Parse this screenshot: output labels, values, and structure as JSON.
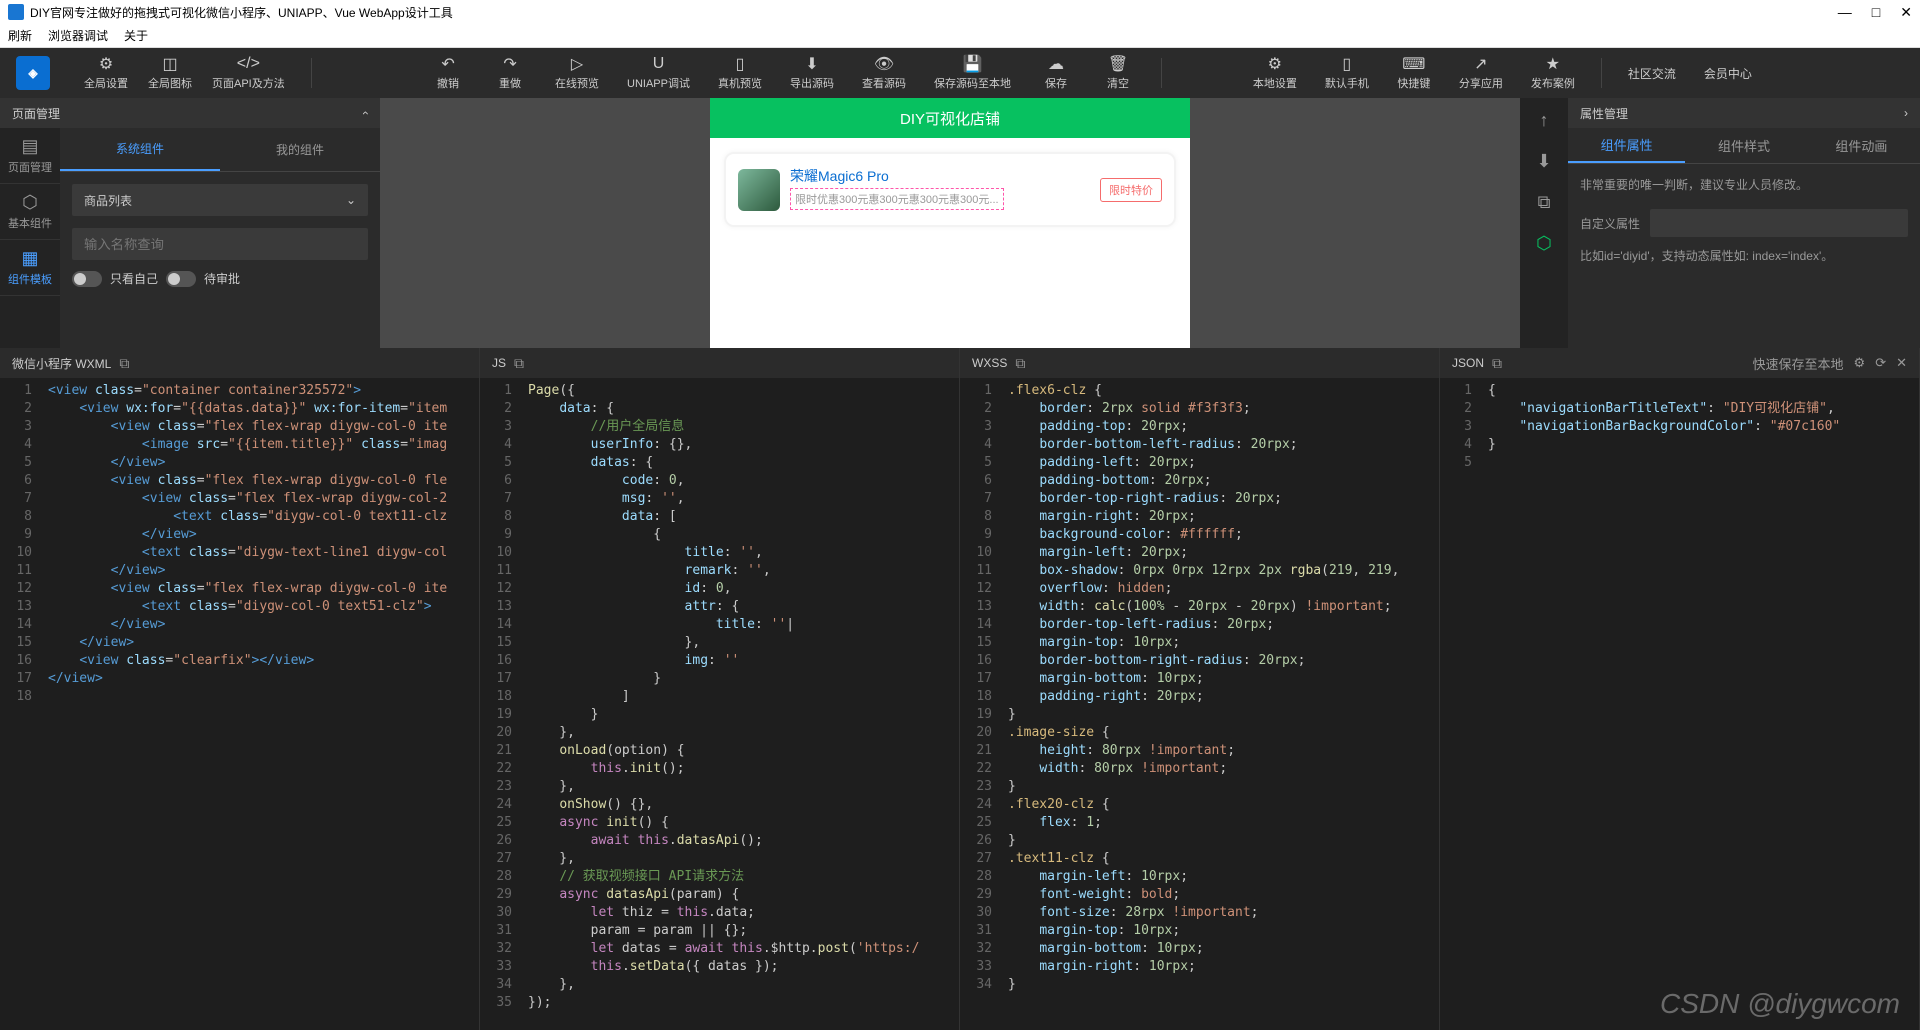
{
  "window": {
    "title": "DIY官网专注做好的拖拽式可视化微信小程序、UNIAPP、Vue WebApp设计工具",
    "minimize": "—",
    "maximize": "□",
    "close": "✕"
  },
  "menubar": [
    "刷新",
    "浏览器调试",
    "关于"
  ],
  "toolbar": {
    "left": [
      {
        "icon": "⚙",
        "label": "全局设置"
      },
      {
        "icon": "◫",
        "label": "全局图标"
      },
      {
        "icon": "</>",
        "label": "页面API及方法"
      }
    ],
    "mid": [
      {
        "icon": "↶",
        "label": "撤销"
      },
      {
        "icon": "↷",
        "label": "重做"
      },
      {
        "icon": "▷",
        "label": "在线预览"
      },
      {
        "icon": "U",
        "label": "UNIAPP调试"
      },
      {
        "icon": "📱",
        "label": "真机预览"
      },
      {
        "icon": "⬇",
        "label": "导出源码"
      },
      {
        "icon": "👁",
        "label": "查看源码"
      },
      {
        "icon": "💾",
        "label": "保存源码至本地"
      },
      {
        "icon": "☁",
        "label": "保存"
      },
      {
        "icon": "🗑",
        "label": "清空"
      }
    ],
    "right": [
      {
        "icon": "⚙",
        "label": "本地设置"
      },
      {
        "icon": "📱",
        "label": "默认手机"
      },
      {
        "icon": "⌨",
        "label": "快捷键"
      },
      {
        "icon": "↗",
        "label": "分享应用"
      },
      {
        "icon": "★",
        "label": "发布案例"
      }
    ],
    "far": [
      "社区交流",
      "会员中心"
    ]
  },
  "leftPanel": {
    "header": "页面管理",
    "sideTabs": [
      {
        "icon": "▤",
        "label": "页面管理"
      },
      {
        "icon": "⬡",
        "label": "基本组件"
      },
      {
        "icon": "▦",
        "label": "组件模板"
      }
    ],
    "compTabs": [
      "系统组件",
      "我的组件"
    ],
    "dropdown": "商品列表",
    "searchPlaceholder": "输入名称查询",
    "onlyMine": "只看自己",
    "pending": "待审批"
  },
  "preview": {
    "title": "DIY可视化店铺",
    "card": {
      "title": "荣耀Magic6 Pro",
      "sub": "限时优惠300元惠300元惠300元惠300元...",
      "badge": "限时特价"
    }
  },
  "rightPanel": {
    "header": "属性管理",
    "tabs": [
      "组件属性",
      "组件样式",
      "组件动画"
    ],
    "hint1": "非常重要的唯一判断，建议专业人员修改。",
    "customLabel": "自定义属性",
    "hint2": "比如id='diyid'，支持动态属性如: index='index'。"
  },
  "codePanels": {
    "wxml": {
      "title": "微信小程序 WXML"
    },
    "js": {
      "title": "JS"
    },
    "wxss": {
      "title": "WXSS"
    },
    "json": {
      "title": "JSON",
      "quickSave": "快速保存至本地"
    }
  },
  "watermark": "CSDN @diygwcom"
}
